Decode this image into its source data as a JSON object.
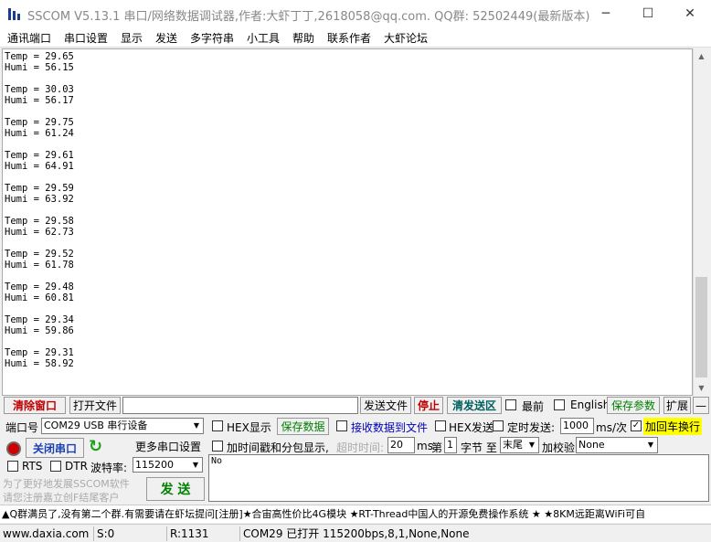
{
  "window": {
    "title": "SSCOM V5.13.1 串口/网络数据调试器,作者:大虾丁丁,2618058@qq.com. QQ群: 52502449(最新版本)"
  },
  "menu": [
    "通讯端口",
    "串口设置",
    "显示",
    "发送",
    "多字符串",
    "小工具",
    "帮助",
    "联系作者",
    "大虾论坛"
  ],
  "output_lines": [
    "Temp = 29.65",
    "Humi = 56.15",
    "",
    "Temp = 30.03",
    "Humi = 56.17",
    "",
    "Temp = 29.75",
    "Humi = 61.24",
    "",
    "Temp = 29.61",
    "Humi = 64.91",
    "",
    "Temp = 29.59",
    "Humi = 63.92",
    "",
    "Temp = 29.58",
    "Humi = 62.73",
    "",
    "Temp = 29.52",
    "Humi = 61.78",
    "",
    "Temp = 29.48",
    "Humi = 60.81",
    "",
    "Temp = 29.34",
    "Humi = 59.86",
    "",
    "Temp = 29.31",
    "Humi = 58.92"
  ],
  "toolbar": {
    "clear_window": "清除窗口",
    "open_file": "打开文件",
    "file_path": "",
    "send_file": "发送文件",
    "stop": "停止",
    "clear_send": "清发送区",
    "topmost": "最前",
    "english": "English",
    "save_params": "保存参数",
    "expand": "扩展",
    "collapse": "—"
  },
  "port": {
    "label": "端口号",
    "value": "COM29 USB 串行设备",
    "close_port": "关闭串口",
    "more_settings": "更多串口设置",
    "rts": "RTS",
    "dtr": "DTR",
    "baud_label": "波特率:",
    "baud_value": "115200"
  },
  "options": {
    "hex_display": "HEX显示",
    "save_data": "保存数据",
    "receive_to_file": "接收数据到文件",
    "hex_send": "HEX发送",
    "timed_send": "定时发送:",
    "interval_value": "1000",
    "interval_unit": "ms/次",
    "add_crlf": "加回车换行",
    "add_timestamp": "加时间戳和分包显示,",
    "timeout_label": "超时时间:",
    "timeout_value": "20",
    "timeout_unit": "ms",
    "byte_prefix": "第",
    "byte_value": "1",
    "byte_label": "字节 至",
    "end_value": "末尾",
    "checksum_label": "加校验",
    "checksum_value": "None"
  },
  "send": {
    "text": "No",
    "send_button": "发 送",
    "promo_line1": "为了更好地发展SSCOM软件",
    "promo_line2": "请您注册嘉立创F结尾客户"
  },
  "ticker": "▲Q群满员了,没有第二个群.有需要请在虾坛提问[注册]★合宙高性价比4G模块 ★RT-Thread中国人的开源免费操作系统 ★ ★8KM远距离WiFi可自",
  "status": {
    "website": "www.daxia.com",
    "sent": "S:0",
    "received": "R:1131",
    "port_status": "COM29 已打开  115200bps,8,1,None,None"
  }
}
